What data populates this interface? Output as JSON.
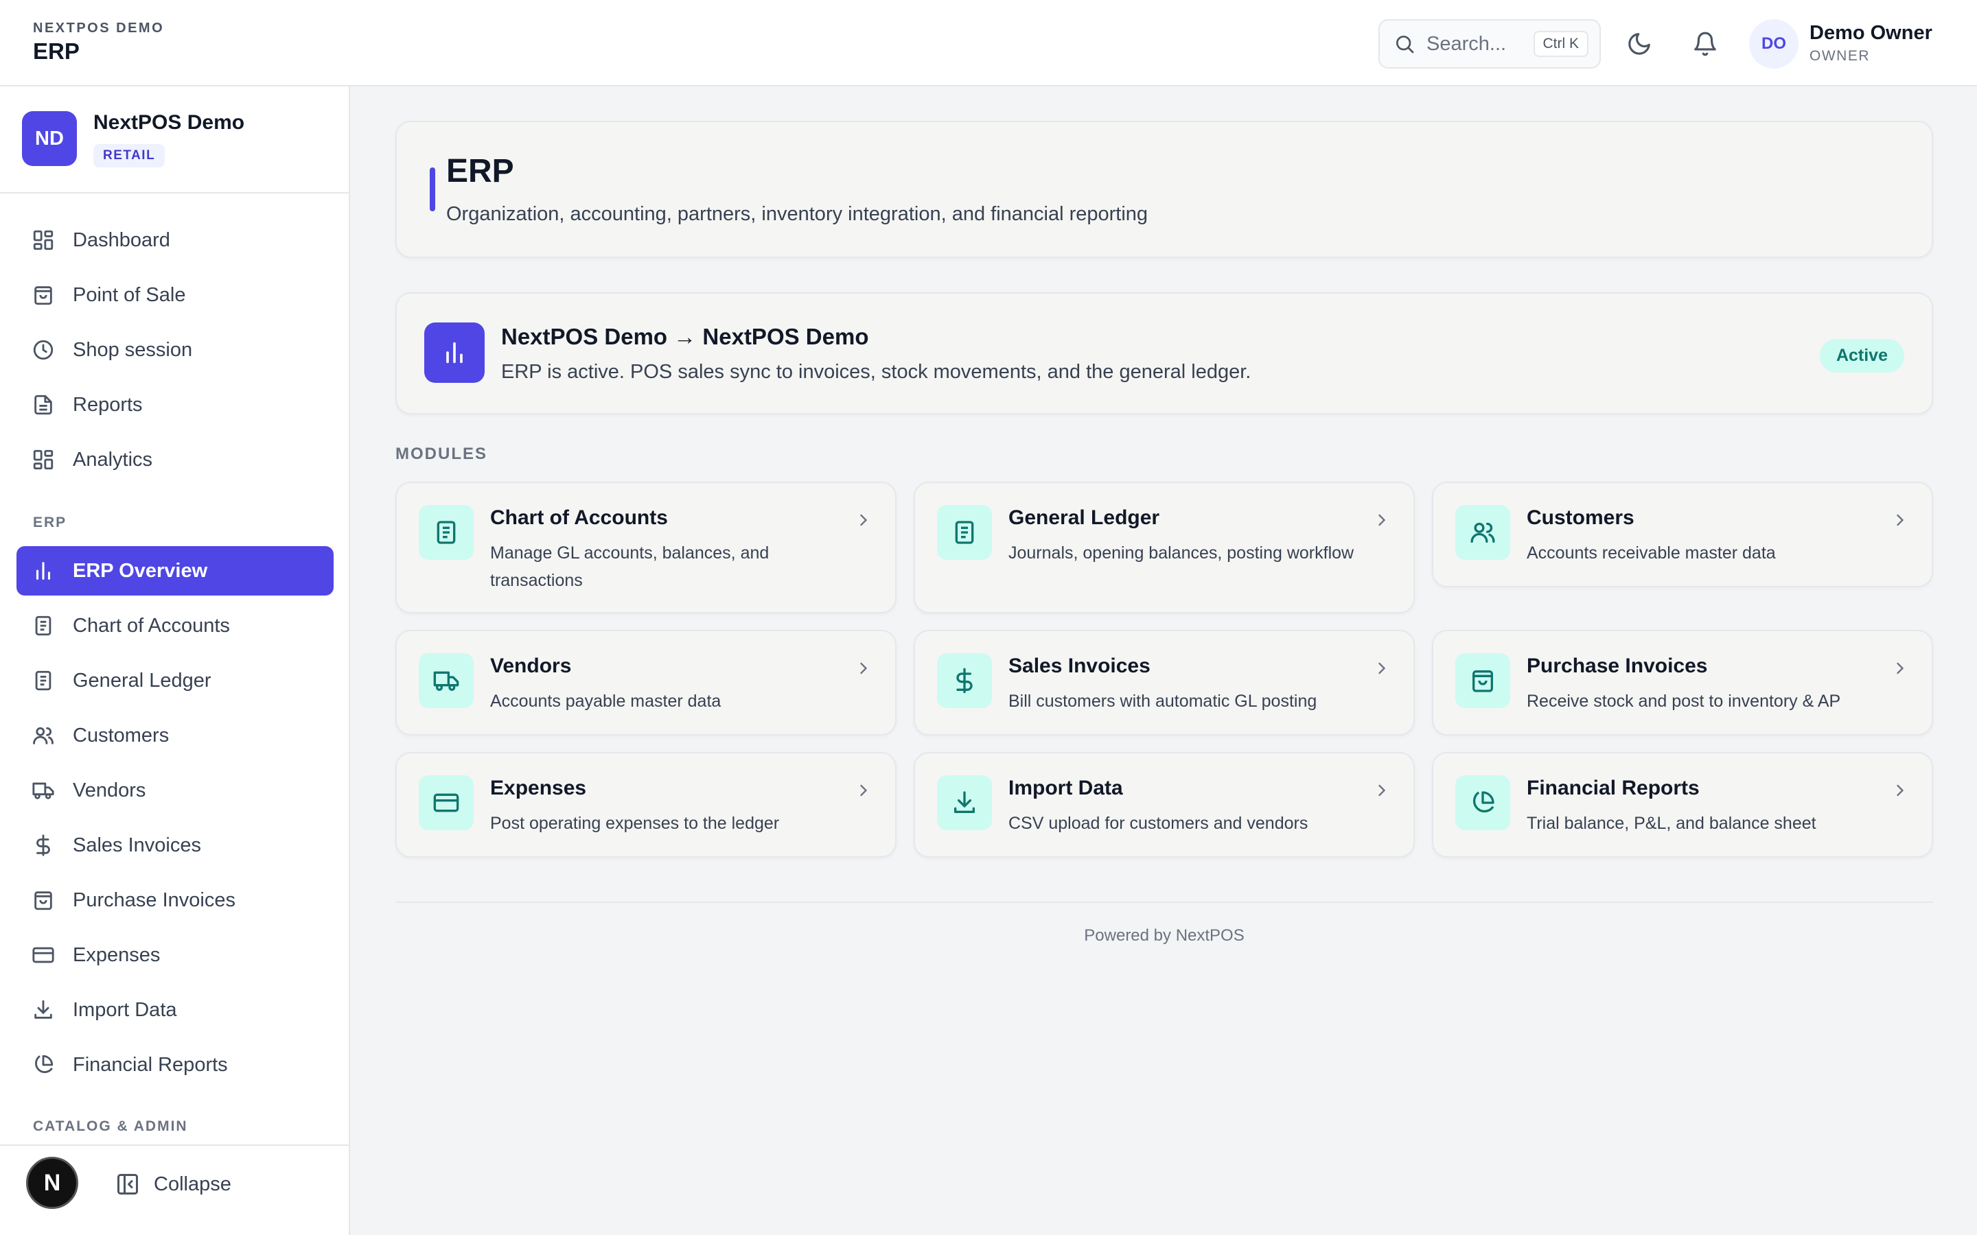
{
  "topbar": {
    "brand_small": "NEXTPOS DEMO",
    "brand_big": "ERP",
    "search_placeholder": "Search...",
    "search_shortcut": "Ctrl K",
    "user_initials": "DO",
    "user_name": "Demo Owner",
    "user_role": "OWNER"
  },
  "sidebar": {
    "org_initials": "ND",
    "org_name": "NextPOS Demo",
    "org_badge": "RETAIL",
    "main_items": [
      {
        "label": "Dashboard",
        "icon": "grid-icon"
      },
      {
        "label": "Point of Sale",
        "icon": "bag-icon"
      },
      {
        "label": "Shop session",
        "icon": "clock-icon"
      },
      {
        "label": "Reports",
        "icon": "document-icon"
      },
      {
        "label": "Analytics",
        "icon": "grid-icon"
      }
    ],
    "erp_section": "ERP",
    "erp_items": [
      {
        "label": "ERP Overview",
        "icon": "bar-chart-icon",
        "active": true
      },
      {
        "label": "Chart of Accounts",
        "icon": "ledger-icon"
      },
      {
        "label": "General Ledger",
        "icon": "ledger-icon"
      },
      {
        "label": "Customers",
        "icon": "users-icon"
      },
      {
        "label": "Vendors",
        "icon": "truck-icon"
      },
      {
        "label": "Sales Invoices",
        "icon": "dollar-icon"
      },
      {
        "label": "Purchase Invoices",
        "icon": "bag-icon"
      },
      {
        "label": "Expenses",
        "icon": "card-icon"
      },
      {
        "label": "Import Data",
        "icon": "download-icon"
      },
      {
        "label": "Financial Reports",
        "icon": "pie-icon"
      }
    ],
    "catalog_section": "CATALOG & ADMIN",
    "bottom_logo": "N",
    "collapse_label": "Collapse"
  },
  "main": {
    "hero_title": "ERP",
    "hero_subtitle": "Organization, accounting, partners, inventory integration, and financial reporting",
    "status_title": "NextPOS Demo → NextPOS Demo",
    "status_subtitle": "ERP is active. POS sales sync to invoices, stock movements, and the general ledger.",
    "status_badge": "Active",
    "modules_label": "MODULES",
    "modules": [
      {
        "title": "Chart of Accounts",
        "desc": "Manage GL accounts, balances, and transactions",
        "icon": "ledger-icon"
      },
      {
        "title": "General Ledger",
        "desc": "Journals, opening balances, posting workflow",
        "icon": "ledger-icon"
      },
      {
        "title": "Customers",
        "desc": "Accounts receivable master data",
        "icon": "users-icon"
      },
      {
        "title": "Vendors",
        "desc": "Accounts payable master data",
        "icon": "truck-icon"
      },
      {
        "title": "Sales Invoices",
        "desc": "Bill customers with automatic GL posting",
        "icon": "dollar-icon"
      },
      {
        "title": "Purchase Invoices",
        "desc": "Receive stock and post to inventory & AP",
        "icon": "bag-icon"
      },
      {
        "title": "Expenses",
        "desc": "Post operating expenses to the ledger",
        "icon": "card-icon"
      },
      {
        "title": "Import Data",
        "desc": "CSV upload for customers and vendors",
        "icon": "download-icon"
      },
      {
        "title": "Financial Reports",
        "desc": "Trial balance, P&L, and balance sheet",
        "icon": "pie-icon"
      }
    ],
    "footer": "Powered by NextPOS"
  },
  "colors": {
    "accent": "#4f46e5",
    "teal": "#0f766e",
    "teal_bg": "#ccfbf1"
  }
}
